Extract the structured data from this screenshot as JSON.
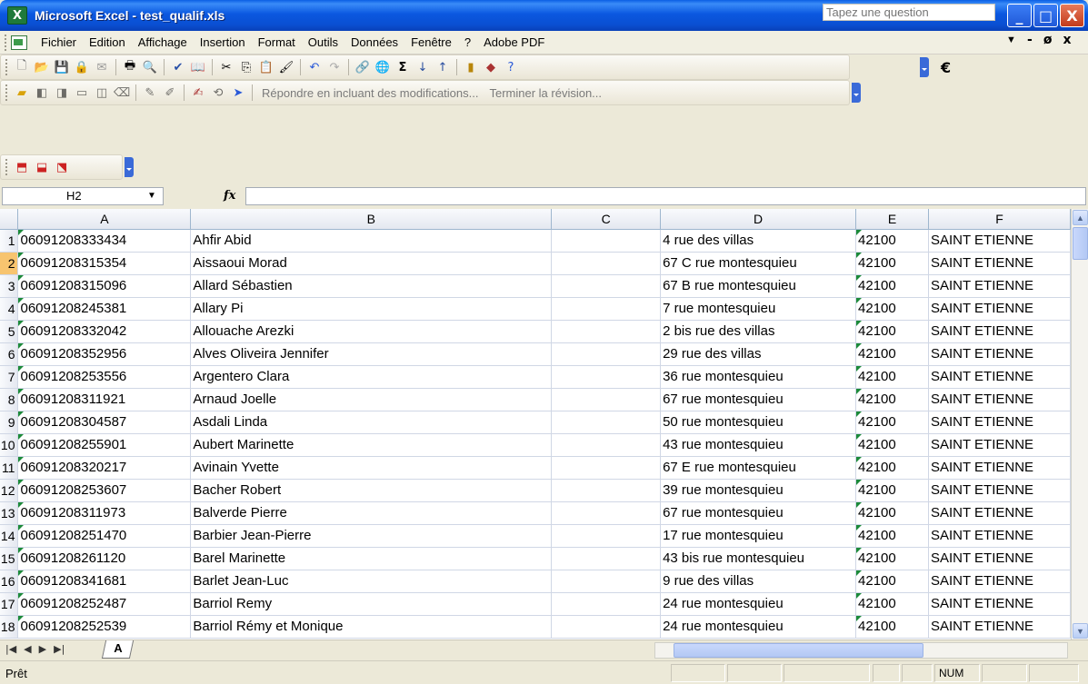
{
  "window": {
    "title": "Microsoft Excel - test_qualif.xls",
    "app_icon_letter": "X",
    "buttons": {
      "minimize": "_",
      "maximize": "□",
      "close": "X"
    }
  },
  "menubar": {
    "items": [
      "Fichier",
      "Edition",
      "Affichage",
      "Insertion",
      "Format",
      "Outils",
      "Données",
      "Fenêtre",
      "?",
      "Adobe PDF"
    ],
    "help_placeholder": "Tapez une question",
    "doc_controls": [
      "-",
      "ø",
      "x"
    ]
  },
  "toolbars": {
    "standard_icons": [
      "new-icon",
      "open-icon",
      "save-icon",
      "permission-icon",
      "email-icon",
      "print-icon",
      "print-preview-icon",
      "spelling-icon",
      "research-icon",
      "cut-icon",
      "copy-icon",
      "paste-icon",
      "format-painter-icon",
      "undo-icon",
      "redo-icon",
      "hyperlink-icon",
      "sum-icon",
      "sort-asc-icon",
      "sort-desc-icon",
      "chart-icon",
      "drawing-icon",
      "help-icon"
    ],
    "euro_symbol": "€",
    "review_text": "Répondre en incluant des modifications...",
    "end_review_text": "Terminer la révision..."
  },
  "formula_bar": {
    "name_box": "H2",
    "fx_symbol": "fx",
    "formula": ""
  },
  "sheet": {
    "columns": [
      "A",
      "B",
      "C",
      "D",
      "E",
      "F"
    ],
    "active_row": 2,
    "rows": [
      {
        "n": "1",
        "a": "06091208333434",
        "b": "Ahfir Abid",
        "c": "",
        "d": "4 rue des villas",
        "e": "42100",
        "f": "SAINT ETIENNE"
      },
      {
        "n": "2",
        "a": "06091208315354",
        "b": "Aissaoui Morad",
        "c": "",
        "d": "67 C rue montesquieu",
        "e": "42100",
        "f": "SAINT ETIENNE"
      },
      {
        "n": "3",
        "a": "06091208315096",
        "b": "Allard Sébastien",
        "c": "",
        "d": "67 B rue montesquieu",
        "e": "42100",
        "f": "SAINT ETIENNE"
      },
      {
        "n": "4",
        "a": "06091208245381",
        "b": "Allary Pi",
        "c": "",
        "d": "7 rue montesquieu",
        "e": "42100",
        "f": "SAINT ETIENNE"
      },
      {
        "n": "5",
        "a": "06091208332042",
        "b": "Allouache Arezki",
        "c": "",
        "d": "2 bis rue des villas",
        "e": "42100",
        "f": "SAINT ETIENNE"
      },
      {
        "n": "6",
        "a": "06091208352956",
        "b": "Alves Oliveira Jennifer",
        "c": "",
        "d": "29 rue des villas",
        "e": "42100",
        "f": "SAINT ETIENNE"
      },
      {
        "n": "7",
        "a": "06091208253556",
        "b": "Argentero Clara",
        "c": "",
        "d": "36 rue montesquieu",
        "e": "42100",
        "f": "SAINT ETIENNE"
      },
      {
        "n": "8",
        "a": "06091208311921",
        "b": "Arnaud Joelle",
        "c": "",
        "d": "67 rue montesquieu",
        "e": "42100",
        "f": "SAINT ETIENNE"
      },
      {
        "n": "9",
        "a": "06091208304587",
        "b": "Asdali Linda",
        "c": "",
        "d": "50 rue montesquieu",
        "e": "42100",
        "f": "SAINT ETIENNE"
      },
      {
        "n": "10",
        "a": "06091208255901",
        "b": "Aubert Marinette",
        "c": "",
        "d": "43 rue montesquieu",
        "e": "42100",
        "f": "SAINT ETIENNE"
      },
      {
        "n": "11",
        "a": "06091208320217",
        "b": "Avinain Yvette",
        "c": "",
        "d": "67 E rue montesquieu",
        "e": "42100",
        "f": "SAINT ETIENNE"
      },
      {
        "n": "12",
        "a": "06091208253607",
        "b": "Bacher Robert",
        "c": "",
        "d": "39 rue montesquieu",
        "e": "42100",
        "f": "SAINT ETIENNE"
      },
      {
        "n": "13",
        "a": "06091208311973",
        "b": "Balverde Pierre",
        "c": "",
        "d": "67 rue montesquieu",
        "e": "42100",
        "f": "SAINT ETIENNE"
      },
      {
        "n": "14",
        "a": "06091208251470",
        "b": "Barbier Jean-Pierre",
        "c": "",
        "d": "17 rue montesquieu",
        "e": "42100",
        "f": "SAINT ETIENNE"
      },
      {
        "n": "15",
        "a": "06091208261120",
        "b": "Barel Marinette",
        "c": "",
        "d": "43 bis rue montesquieu",
        "e": "42100",
        "f": "SAINT ETIENNE"
      },
      {
        "n": "16",
        "a": "06091208341681",
        "b": "Barlet Jean-Luc",
        "c": "",
        "d": "9 rue des villas",
        "e": "42100",
        "f": "SAINT ETIENNE"
      },
      {
        "n": "17",
        "a": "06091208252487",
        "b": "Barriol Remy",
        "c": "",
        "d": "24 rue montesquieu",
        "e": "42100",
        "f": "SAINT ETIENNE"
      },
      {
        "n": "18",
        "a": "06091208252539",
        "b": "Barriol Rémy et Monique",
        "c": "",
        "d": "24 rue montesquieu",
        "e": "42100",
        "f": "SAINT ETIENNE"
      }
    ]
  },
  "tabs": {
    "active": "A"
  },
  "status": {
    "ready": "Prêt",
    "num": "NUM"
  },
  "colors": {
    "titlebar": "#0a4fd2",
    "active_row_header": "#f7c46f",
    "grid_line": "#d0d7e5"
  }
}
